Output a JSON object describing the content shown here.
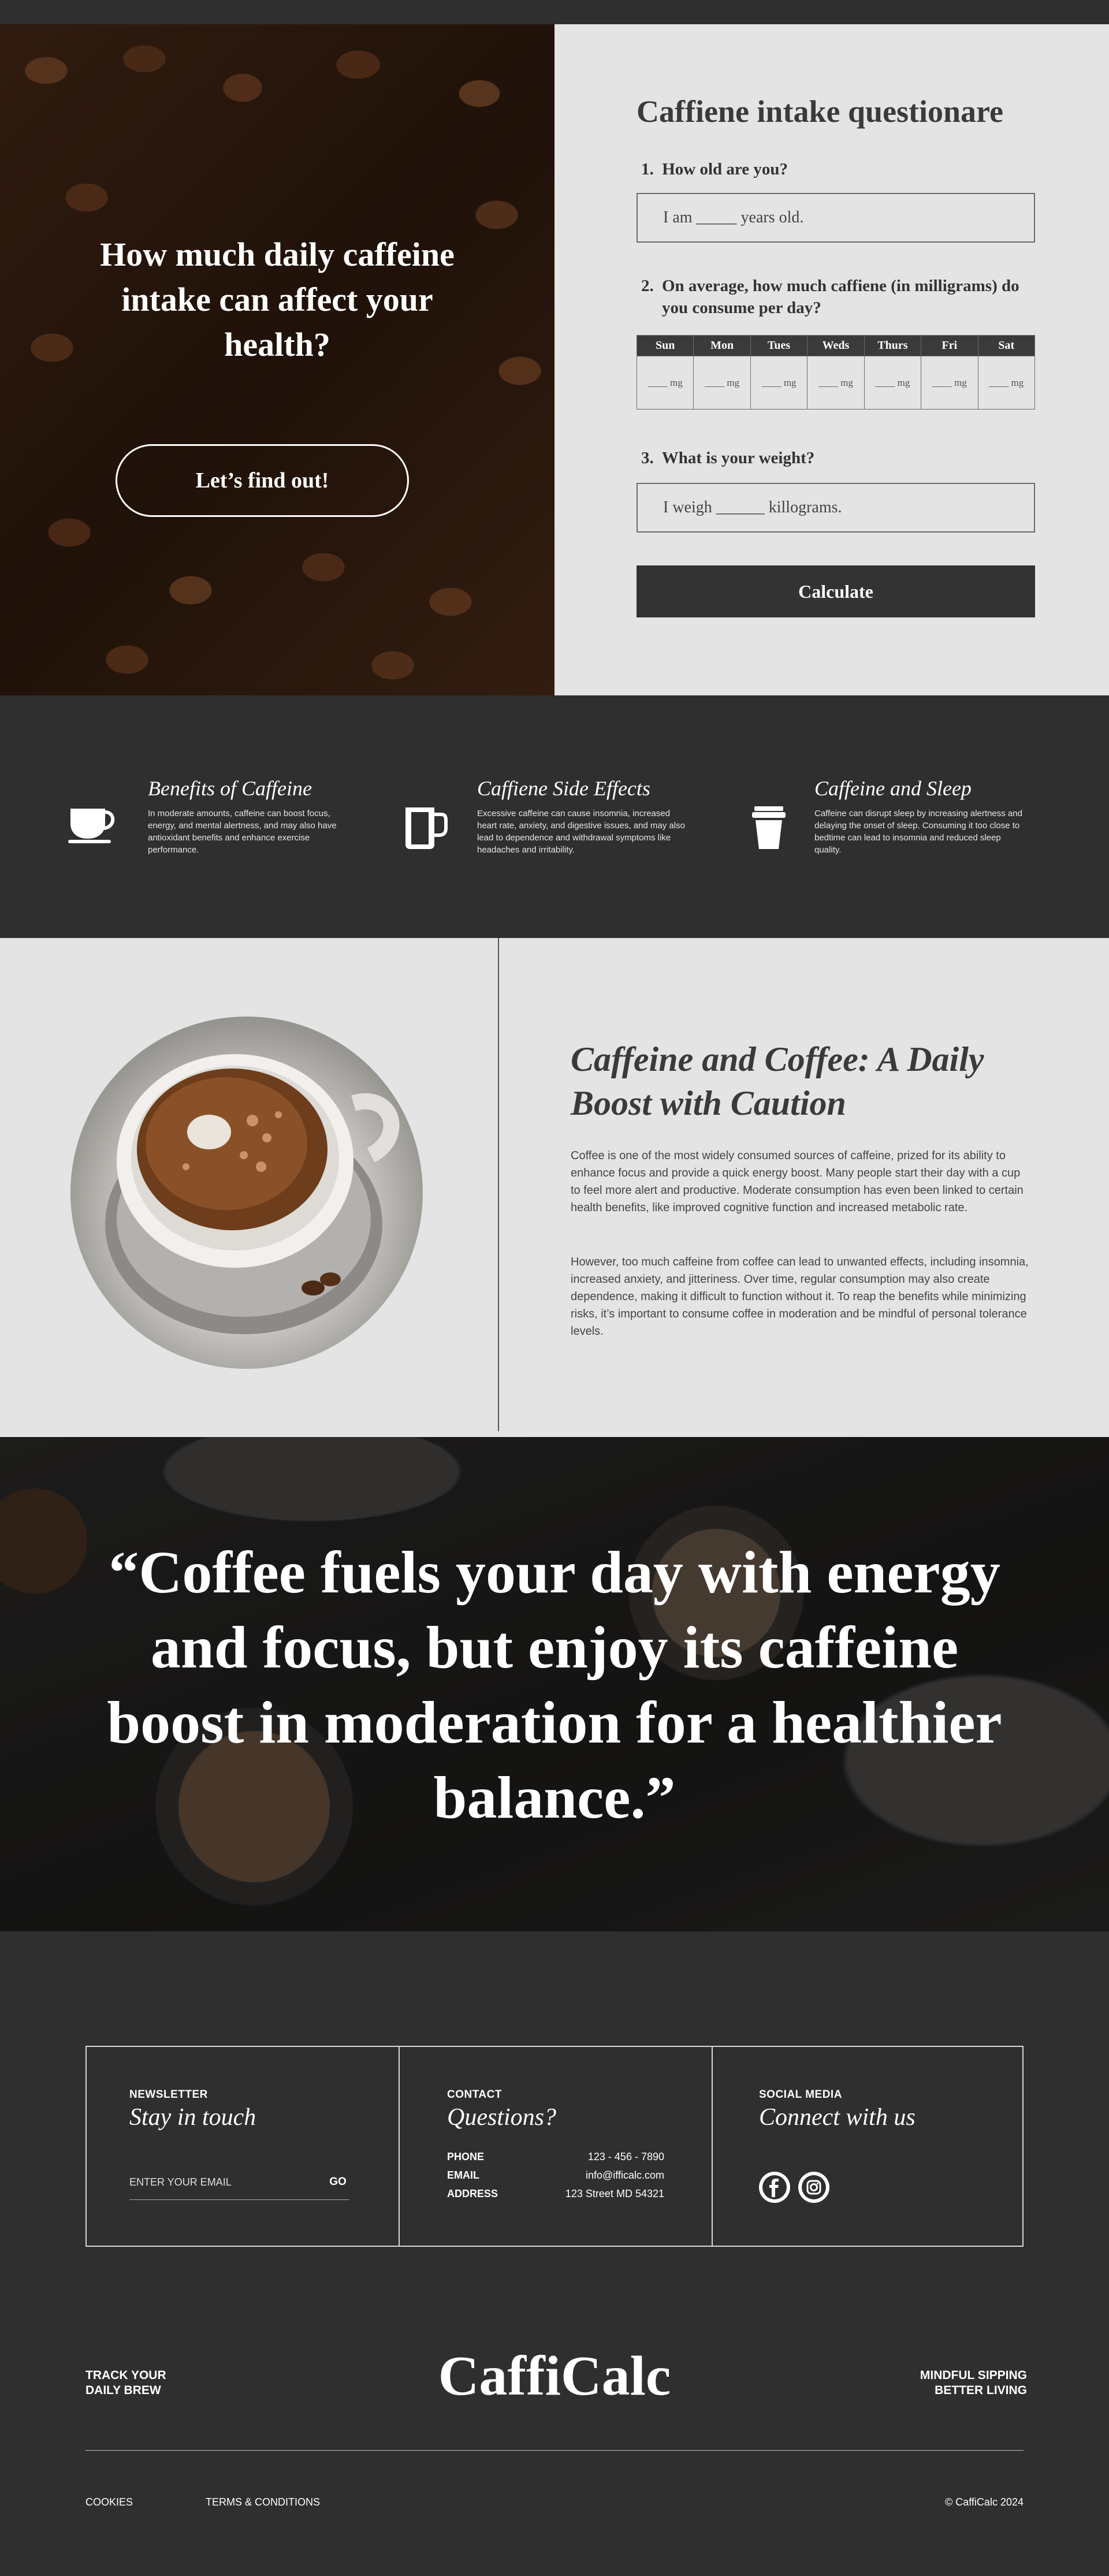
{
  "hero": {
    "title": "How much daily caffeine intake can affect your health?",
    "cta_label": "Let’s find out!"
  },
  "questionnaire": {
    "title": "Caffiene intake questionare",
    "q1": {
      "number": "1.",
      "label": "How old are you?",
      "value": "I am _____ years old."
    },
    "q2": {
      "number": "2.",
      "label": "On average, how much caffiene (in milligrams) do you consume per day?",
      "days": [
        "Sun",
        "Mon",
        "Tues",
        "Weds",
        "Thurs",
        "Fri",
        "Sat"
      ],
      "cell_value": "____ mg"
    },
    "q3": {
      "number": "3.",
      "label": "What is your weight?",
      "value": "I weigh ______ killograms."
    },
    "calculate_label": "Calculate"
  },
  "features": [
    {
      "title": "Benefits of Caffeine",
      "icon": "coffee-cup-icon",
      "text": "In moderate amounts, caffeine can boost focus, energy, and mental alertness, and may also have antioxidant benefits and enhance exercise performance."
    },
    {
      "title": "Caffiene Side Effects",
      "icon": "mug-icon",
      "text": "Excessive caffeine can cause insomnia, increased heart rate, anxiety, and digestive issues, and may also lead to dependence and withdrawal symptoms like headaches and irritability."
    },
    {
      "title": "Caffeine and Sleep",
      "icon": "takeaway-cup-icon",
      "text": "Caffeine can disrupt sleep by increasing alertness and delaying the onset of sleep. Consuming it too close to bedtime can lead to insomnia and reduced sleep quality."
    }
  ],
  "article": {
    "title": "Caffeine and Coffee: A Daily Boost with Caution",
    "para1": "Coffee is one of the most widely consumed sources of caffeine, prized for its ability to enhance focus and provide a quick energy boost. Many people start their day with a cup to feel more alert and productive. Moderate consumption has even been linked to certain health benefits, like improved cognitive function and increased metabolic rate.",
    "para2": "However, too much caffeine from coffee can lead to unwanted effects, including insomnia, increased anxiety, and jitteriness. Over time, regular consumption may also create dependence, making it difficult to function without it. To reap the benefits while minimizing risks, it’s important to consume coffee in moderation and be mindful of personal tolerance levels."
  },
  "quote": {
    "text": "“Coffee fuels your day with energy and focus, but enjoy its caffeine boost in moderation for a healthier balance.”"
  },
  "footer": {
    "newsletter": {
      "eyebrow": "NEWSLETTER",
      "heading": "Stay in touch",
      "email_placeholder": "ENTER YOUR EMAIL",
      "go_label": "GO"
    },
    "contact": {
      "eyebrow": "CONTACT",
      "heading": "Questions?",
      "rows": [
        {
          "label": "PHONE",
          "value": "123 - 456 - 7890"
        },
        {
          "label": "EMAIL",
          "value": "info@ifficalc.com"
        },
        {
          "label": "ADDRESS",
          "value": "123 Street MD 54321"
        }
      ]
    },
    "social": {
      "eyebrow": "SOCIAL MEDIA",
      "heading": "Connect with us",
      "icons": [
        "facebook-icon",
        "instagram-icon"
      ]
    },
    "tagline_left": [
      "TRACK YOUR",
      "DAILY BREW"
    ],
    "brand": "CaffiCalc",
    "tagline_right": [
      "MINDFUL SIPPING",
      "BETTER LIVING"
    ],
    "links": [
      "COOKIES",
      "TERMS & CONDITIONS"
    ],
    "copyright": "© CaffiCalc 2024"
  }
}
